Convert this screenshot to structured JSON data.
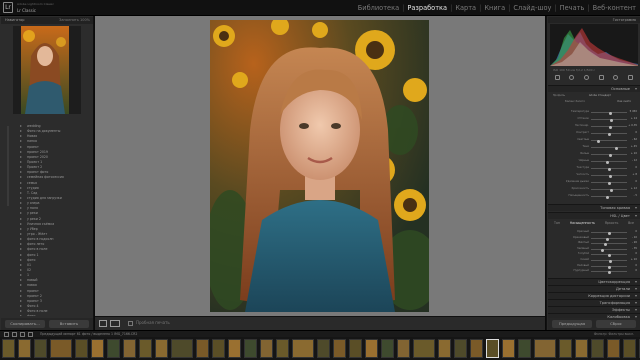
{
  "topbar": {
    "user_line": "Adobe Lightroom Classic",
    "app_name": "Lr Classic",
    "logo": "Lr",
    "modules": [
      {
        "label": "Библиотека",
        "active": false
      },
      {
        "label": "Разработка",
        "active": true
      },
      {
        "label": "Карта",
        "active": false
      },
      {
        "label": "Книга",
        "active": false
      },
      {
        "label": "Слайд-шоу",
        "active": false
      },
      {
        "label": "Печать",
        "active": false
      },
      {
        "label": "Веб-контент",
        "active": false
      }
    ]
  },
  "left_panel": {
    "navigator_title": "Навигатор",
    "navigator_options": "Заполнить  100%",
    "folders": [
      {
        "name": "wedding",
        "count": ""
      },
      {
        "name": "Фото на документы",
        "count": ""
      },
      {
        "name": "Новая",
        "count": ""
      },
      {
        "name": "папка",
        "count": ""
      },
      {
        "name": "проект",
        "count": ""
      },
      {
        "name": "проект 2019",
        "count": ""
      },
      {
        "name": "проект 2020",
        "count": ""
      },
      {
        "name": "Проект 1",
        "count": ""
      },
      {
        "name": "Проект 2",
        "count": ""
      },
      {
        "name": "проект фото",
        "count": ""
      },
      {
        "name": "семейная фотосессия",
        "count": ""
      },
      {
        "name": "семья",
        "count": ""
      },
      {
        "name": "студия",
        "count": ""
      },
      {
        "name": "Т. Сад",
        "count": ""
      },
      {
        "name": "студия для загрузки",
        "count": ""
      },
      {
        "name": "у озера",
        "count": ""
      },
      {
        "name": "у поля",
        "count": ""
      },
      {
        "name": "у реки",
        "count": ""
      },
      {
        "name": "у реки 2",
        "count": ""
      },
      {
        "name": "Уличная съёмка",
        "count": ""
      },
      {
        "name": "у Убер",
        "count": ""
      },
      {
        "name": "утро - Жёлт",
        "count": ""
      },
      {
        "name": "фото в подсолн",
        "count": ""
      },
      {
        "name": "фото лето",
        "count": ""
      },
      {
        "name": "фото в поле",
        "count": ""
      },
      {
        "name": "фото 1",
        "count": ""
      },
      {
        "name": "фото",
        "count": ""
      },
      {
        "name": "01",
        "count": ""
      },
      {
        "name": "02",
        "count": ""
      },
      {
        "name": "1",
        "count": ""
      },
      {
        "name": "новый",
        "count": ""
      },
      {
        "name": "новая",
        "count": ""
      },
      {
        "name": "проект",
        "count": ""
      },
      {
        "name": "проект 2",
        "count": ""
      },
      {
        "name": "проект 3",
        "count": ""
      },
      {
        "name": "Фото 4",
        "count": ""
      },
      {
        "name": "Фото в поле",
        "count": ""
      },
      {
        "name": "фото",
        "count": ""
      },
      {
        "name": "фото",
        "count": ""
      }
    ],
    "copy_button": "Скопировать...",
    "paste_button": "Вставить"
  },
  "center": {
    "soft_proof_label": "Пробная печать"
  },
  "right_panel": {
    "histogram_title": "Гистограмма",
    "hist_info": "ISO 100   50 мм   f/2,2   1/500 с",
    "basic_title": "Основные",
    "profile_label": "Профиль",
    "profile_value": "Adobe Стандарт",
    "wb_label": "Баланс белого",
    "wb_value": "Как снято",
    "rows": [
      {
        "label": "Температура",
        "value": "5 450",
        "pos": 0.55
      },
      {
        "label": "Оттенок",
        "value": "+ 14",
        "pos": 0.58
      },
      {
        "label": "Экспонир.",
        "value": "+ 0,35",
        "pos": 0.55
      },
      {
        "label": "Контраст",
        "value": "0",
        "pos": 0.5
      },
      {
        "label": "Светлые",
        "value": "- 62",
        "pos": 0.2
      },
      {
        "label": "Тени",
        "value": "+ 45",
        "pos": 0.72
      },
      {
        "label": "Белые",
        "value": "+ 10",
        "pos": 0.55
      },
      {
        "label": "Чёрные",
        "value": "- 12",
        "pos": 0.45
      },
      {
        "label": "Текстура",
        "value": "0",
        "pos": 0.5
      },
      {
        "label": "Четкость",
        "value": "+ 8",
        "pos": 0.54
      },
      {
        "label": "Удаление дымки",
        "value": "0",
        "pos": 0.5
      },
      {
        "label": "Красочность",
        "value": "+ 12",
        "pos": 0.56
      },
      {
        "label": "Насыщенность",
        "value": "- 5",
        "pos": 0.47
      }
    ],
    "tone_curve_title": "Тоновая кривая",
    "hsl_title": "HSL / Цвет",
    "hsl_tabs": [
      {
        "label": "Тон",
        "active": false
      },
      {
        "label": "Насыщенность",
        "active": true
      },
      {
        "label": "Яркость",
        "active": false
      },
      {
        "label": "Все",
        "active": false
      }
    ],
    "hsl_rows": [
      {
        "label": "Красный",
        "value": "0",
        "pos": 0.5
      },
      {
        "label": "Оранжевый",
        "value": "- 10",
        "pos": 0.45
      },
      {
        "label": "Жёлтый",
        "value": "- 20",
        "pos": 0.4
      },
      {
        "label": "Зелёный",
        "value": "- 35",
        "pos": 0.32
      },
      {
        "label": "Голубой",
        "value": "0",
        "pos": 0.5
      },
      {
        "label": "Синий",
        "value": "+ 10",
        "pos": 0.55
      },
      {
        "label": "Лиловый",
        "value": "0",
        "pos": 0.5
      },
      {
        "label": "Пурпурный",
        "value": "0",
        "pos": 0.5
      }
    ],
    "sections": [
      {
        "title": "Цветокоррекция"
      },
      {
        "title": "Детали"
      },
      {
        "title": "Коррекция дисторсии"
      },
      {
        "title": "Трансформация"
      },
      {
        "title": "Эффекты"
      },
      {
        "title": "Калибровка"
      }
    ],
    "previous_button": "Предыдущая",
    "reset_button": "Сброс"
  },
  "filmstrip": {
    "info": "Предыдущий импорт   61 фото / выделено 1   IMG_7166.CR2",
    "filter_label": "Фильтр:  Фильтры выкл.",
    "selected_index": 28,
    "thumb_count": 60
  }
}
